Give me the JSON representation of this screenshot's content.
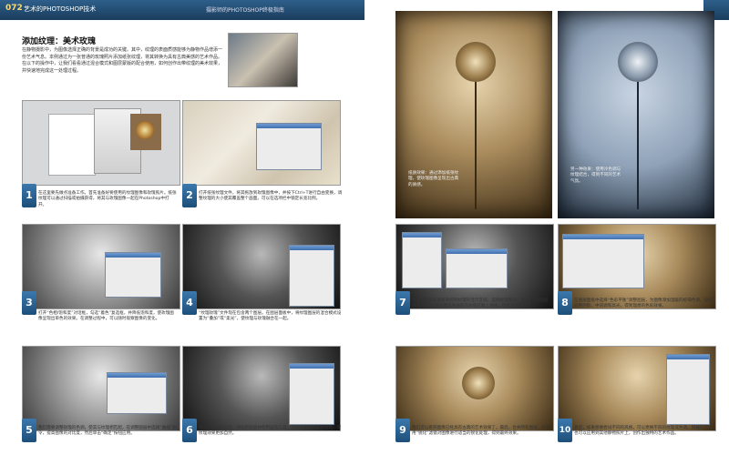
{
  "header": {
    "page_number": "072",
    "section": "艺术的PHOTOSHOP技术",
    "book_title": "摄影师的PHOTOSHOP终极指南"
  },
  "article": {
    "title": "添加纹理：美术玫瑰",
    "intro": "在静物摄影中，为图像选择正确的背景是成功的关键。其中，纹理的表面质感能够为静物作品增添一份艺术气息。本例通过为一张普通的玫瑰照片添加纸张纹理，将其转换为具有古典美感的艺术作品。在以下的操作中，让我们看看通过混合模式和图层蒙版的配合使用，如何创作出带纹理的美术效果，并快速地完成这一处理过程。"
  },
  "steps": [
    {
      "number": "1",
      "caption": "在这里要先做点准备工作。首先准备好要使用的纹理图像和玫瑰照片。纸张纹理可以通过扫描或拍摄获得，将其与玫瑰图像一起在Photoshop中打开。"
    },
    {
      "number": "2",
      "caption": "打开纸张纹理文件，将其拖放到玫瑰图像中，并按下Ctrl+T进行自由变换，调整纹理的大小使其覆盖整个画面。可以在选项栏中锁定长宽比例。"
    },
    {
      "number": "3",
      "caption": "打开“色相/饱和度”对话框，勾选“着色”复选框，并降低饱和度，使玫瑰图像呈现出单色的效果。在调整过程中，可以随时观察图像的变化。"
    },
    {
      "number": "4",
      "caption": "“纹理玫瑰”文件现在包含两个图层。在图层面板中，将纹理图层的混合模式设置为“叠加”或“柔光”，使纹理与玫瑰融合在一起。"
    },
    {
      "number": "5",
      "caption": "我们需要调整玫瑰的色调，使其与纹理相匹配。在调整图层中选择“曲线”命令，提高图像的对比度，然后单击“确定”按钮应用。"
    },
    {
      "number": "6",
      "caption": "现在打开新的文档，添加新图层并使用画笔工具，在玫瑰的边缘部分绘制，使纹理效果更加自然。"
    },
    {
      "number": "7",
      "caption": "现在利用图层蒙版来控制纹理的显示区域。选择纹理图层，单击“添加图层蒙版”按钮，然后用黑色画笔在玫瑰花瓣上涂抹，恢复花朵的细节。"
    },
    {
      "number": "8",
      "caption": "在图层面板中选择“色彩平衡”调整图层，为图像添加温暖的棕褐色调。分别调整阴影、中间调和高光，得到理想的色彩效果。"
    },
    {
      "number": "9",
      "caption": "我们可以看到图像已经具有古典的艺术效果了。最后，合并所有图层，并使用“锐化”滤镜对图像进行适当的锐化处理，得到最终效果。"
    },
    {
      "number": "10",
      "caption": "最后，如果想要尝试不同的风格，可以更换不同的纹理或色调。同样的方法也可以应用到其他静物照片上，创作出独特的艺术作品。"
    }
  ],
  "finals": {
    "sepia_note": "纸质效果：通过添加纸张纹理，使玫瑰图像呈现出古典的质感。",
    "blue_note": "另一种效果：使用冷色调与纹理结合，得到不同的艺术气氛。"
  }
}
